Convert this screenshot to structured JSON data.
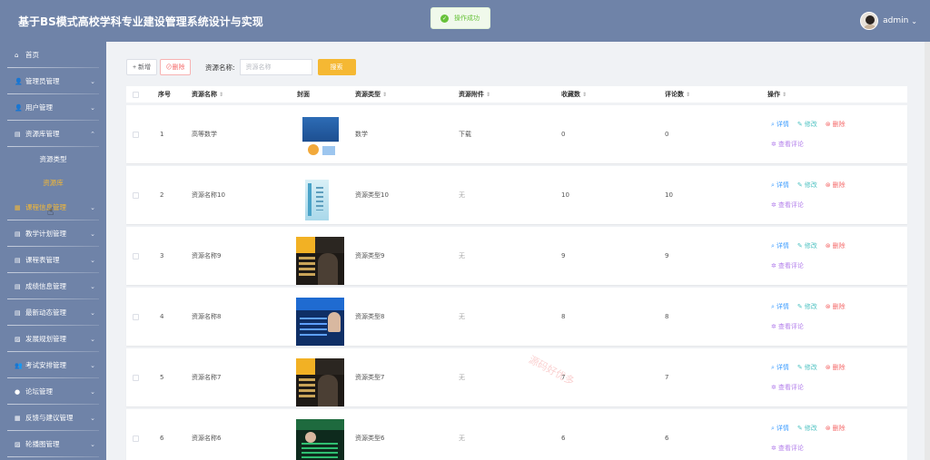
{
  "app": {
    "title": "基于BS模式高校学科专业建设管理系统设计与实现"
  },
  "user": {
    "name": "admin"
  },
  "toast": {
    "text": "操作成功"
  },
  "sidebar": {
    "items": [
      {
        "label": "首页",
        "icon": "home-icon",
        "glyph": "⌂",
        "has_arrow": false
      },
      {
        "label": "管理员管理",
        "icon": "user-icon",
        "glyph": "👤",
        "has_arrow": true
      },
      {
        "label": "用户管理",
        "icon": "user-icon",
        "glyph": "👤",
        "has_arrow": true
      },
      {
        "label": "资源库管理",
        "icon": "list-icon",
        "glyph": "▤",
        "has_arrow": true,
        "expanded": true,
        "children": [
          {
            "label": "资源类型"
          },
          {
            "label": "资源库",
            "current": true
          }
        ]
      },
      {
        "label": "课程信息管理",
        "icon": "grid-icon",
        "glyph": "▦",
        "has_arrow": true,
        "active": true
      },
      {
        "label": "教学计划管理",
        "icon": "list-icon",
        "glyph": "▤",
        "has_arrow": true
      },
      {
        "label": "课程表管理",
        "icon": "list-icon",
        "glyph": "▤",
        "has_arrow": true
      },
      {
        "label": "成绩信息管理",
        "icon": "list-icon",
        "glyph": "▤",
        "has_arrow": true
      },
      {
        "label": "最新动态管理",
        "icon": "list-icon",
        "glyph": "▤",
        "has_arrow": true
      },
      {
        "label": "发展规划管理",
        "icon": "image-icon",
        "glyph": "▨",
        "has_arrow": true
      },
      {
        "label": "考试安排管理",
        "icon": "users-icon",
        "glyph": "👥",
        "has_arrow": true
      },
      {
        "label": "论坛管理",
        "icon": "circle-icon",
        "glyph": "●",
        "has_arrow": true
      },
      {
        "label": "反馈与建议管理",
        "icon": "grid-icon",
        "glyph": "▦",
        "has_arrow": true
      },
      {
        "label": "轮播图管理",
        "icon": "image-icon",
        "glyph": "▨",
        "has_arrow": true
      }
    ]
  },
  "toolbar": {
    "add_label": "+ 新增",
    "delete_label": "⊘删除",
    "search_label": "资源名称:",
    "search_placeholder": "资源名称",
    "search_button": "搜索"
  },
  "table": {
    "columns": [
      "序号",
      "资源名称",
      "封面",
      "资源类型",
      "资源附件",
      "收藏数",
      "评论数",
      "操作"
    ],
    "actions": {
      "detail": "详情",
      "edit": "修改",
      "delete": "删除",
      "comments": "查看评论"
    },
    "rows": [
      {
        "index": "1",
        "name": "高等数学",
        "cover": "math",
        "type": "数学",
        "attachment": "下载",
        "favorites": "0",
        "comments": "0"
      },
      {
        "index": "2",
        "name": "资源名称10",
        "cover": "book",
        "type": "资源类型10",
        "attachment": "无",
        "favorites": "10",
        "comments": "10"
      },
      {
        "index": "3",
        "name": "资源名称9",
        "cover": "poster",
        "type": "资源类型9",
        "attachment": "无",
        "favorites": "9",
        "comments": "9"
      },
      {
        "index": "4",
        "name": "资源名称8",
        "cover": "blue",
        "type": "资源类型8",
        "attachment": "无",
        "favorites": "8",
        "comments": "8"
      },
      {
        "index": "5",
        "name": "资源名称7",
        "cover": "poster",
        "type": "资源类型7",
        "attachment": "无",
        "favorites": "7",
        "comments": "7"
      },
      {
        "index": "6",
        "name": "资源名称6",
        "cover": "green",
        "type": "资源类型6",
        "attachment": "无",
        "favorites": "6",
        "comments": "6"
      }
    ]
  },
  "watermark": "源码好优多"
}
